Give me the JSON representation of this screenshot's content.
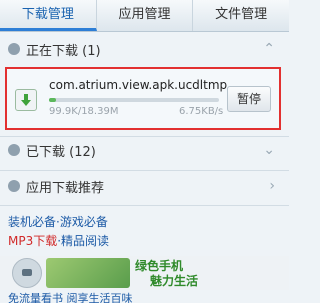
{
  "tabs": [
    {
      "label": "下载管理",
      "active": true
    },
    {
      "label": "应用管理",
      "active": false
    },
    {
      "label": "文件管理",
      "active": false
    }
  ],
  "downloading": {
    "header": "正在下载 (1)",
    "item": {
      "name": "com.atrium.view.apk.ucdltmp",
      "size_text": "99.9K/18.39M",
      "speed_text": "6.75KB/s",
      "progress_fraction": 0.005,
      "pause_label": "暂停"
    }
  },
  "downloaded": {
    "header": "已下载 (12)"
  },
  "recommend": {
    "header": "应用下载推荐"
  },
  "links": {
    "line1": "装机必备·游戏必备",
    "line2_red": "MP3下载",
    "line2_blue": "·精品阅读"
  },
  "banner": {
    "title1": "绿色手机",
    "title2": "魅力生活",
    "caption": "免流量看书 阅享生活百味"
  },
  "colors": {
    "active_tab": "#1a63b0",
    "highlight_border": "#e23030",
    "progress": "#5cb85c",
    "link": "#1c5aa6"
  }
}
